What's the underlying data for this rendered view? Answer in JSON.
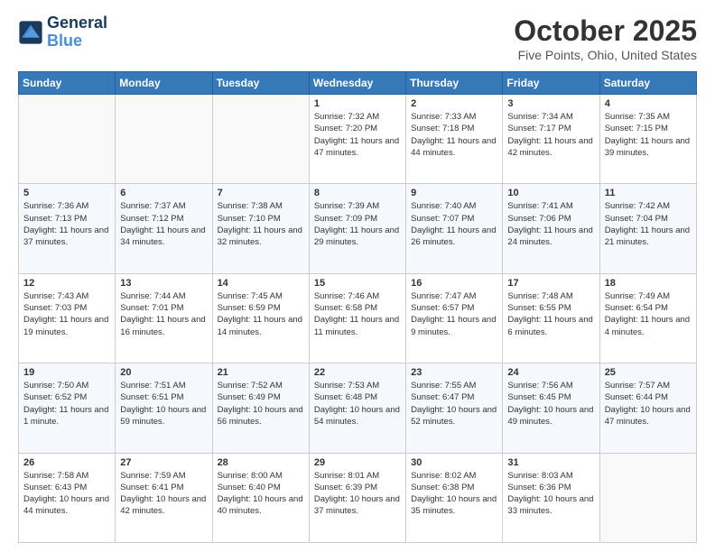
{
  "header": {
    "logo_line1": "General",
    "logo_line2": "Blue",
    "month_title": "October 2025",
    "location": "Five Points, Ohio, United States"
  },
  "weekdays": [
    "Sunday",
    "Monday",
    "Tuesday",
    "Wednesday",
    "Thursday",
    "Friday",
    "Saturday"
  ],
  "weeks": [
    [
      {
        "day": "",
        "sunrise": "",
        "sunset": "",
        "daylight": ""
      },
      {
        "day": "",
        "sunrise": "",
        "sunset": "",
        "daylight": ""
      },
      {
        "day": "",
        "sunrise": "",
        "sunset": "",
        "daylight": ""
      },
      {
        "day": "1",
        "sunrise": "Sunrise: 7:32 AM",
        "sunset": "Sunset: 7:20 PM",
        "daylight": "Daylight: 11 hours and 47 minutes."
      },
      {
        "day": "2",
        "sunrise": "Sunrise: 7:33 AM",
        "sunset": "Sunset: 7:18 PM",
        "daylight": "Daylight: 11 hours and 44 minutes."
      },
      {
        "day": "3",
        "sunrise": "Sunrise: 7:34 AM",
        "sunset": "Sunset: 7:17 PM",
        "daylight": "Daylight: 11 hours and 42 minutes."
      },
      {
        "day": "4",
        "sunrise": "Sunrise: 7:35 AM",
        "sunset": "Sunset: 7:15 PM",
        "daylight": "Daylight: 11 hours and 39 minutes."
      }
    ],
    [
      {
        "day": "5",
        "sunrise": "Sunrise: 7:36 AM",
        "sunset": "Sunset: 7:13 PM",
        "daylight": "Daylight: 11 hours and 37 minutes."
      },
      {
        "day": "6",
        "sunrise": "Sunrise: 7:37 AM",
        "sunset": "Sunset: 7:12 PM",
        "daylight": "Daylight: 11 hours and 34 minutes."
      },
      {
        "day": "7",
        "sunrise": "Sunrise: 7:38 AM",
        "sunset": "Sunset: 7:10 PM",
        "daylight": "Daylight: 11 hours and 32 minutes."
      },
      {
        "day": "8",
        "sunrise": "Sunrise: 7:39 AM",
        "sunset": "Sunset: 7:09 PM",
        "daylight": "Daylight: 11 hours and 29 minutes."
      },
      {
        "day": "9",
        "sunrise": "Sunrise: 7:40 AM",
        "sunset": "Sunset: 7:07 PM",
        "daylight": "Daylight: 11 hours and 26 minutes."
      },
      {
        "day": "10",
        "sunrise": "Sunrise: 7:41 AM",
        "sunset": "Sunset: 7:06 PM",
        "daylight": "Daylight: 11 hours and 24 minutes."
      },
      {
        "day": "11",
        "sunrise": "Sunrise: 7:42 AM",
        "sunset": "Sunset: 7:04 PM",
        "daylight": "Daylight: 11 hours and 21 minutes."
      }
    ],
    [
      {
        "day": "12",
        "sunrise": "Sunrise: 7:43 AM",
        "sunset": "Sunset: 7:03 PM",
        "daylight": "Daylight: 11 hours and 19 minutes."
      },
      {
        "day": "13",
        "sunrise": "Sunrise: 7:44 AM",
        "sunset": "Sunset: 7:01 PM",
        "daylight": "Daylight: 11 hours and 16 minutes."
      },
      {
        "day": "14",
        "sunrise": "Sunrise: 7:45 AM",
        "sunset": "Sunset: 6:59 PM",
        "daylight": "Daylight: 11 hours and 14 minutes."
      },
      {
        "day": "15",
        "sunrise": "Sunrise: 7:46 AM",
        "sunset": "Sunset: 6:58 PM",
        "daylight": "Daylight: 11 hours and 11 minutes."
      },
      {
        "day": "16",
        "sunrise": "Sunrise: 7:47 AM",
        "sunset": "Sunset: 6:57 PM",
        "daylight": "Daylight: 11 hours and 9 minutes."
      },
      {
        "day": "17",
        "sunrise": "Sunrise: 7:48 AM",
        "sunset": "Sunset: 6:55 PM",
        "daylight": "Daylight: 11 hours and 6 minutes."
      },
      {
        "day": "18",
        "sunrise": "Sunrise: 7:49 AM",
        "sunset": "Sunset: 6:54 PM",
        "daylight": "Daylight: 11 hours and 4 minutes."
      }
    ],
    [
      {
        "day": "19",
        "sunrise": "Sunrise: 7:50 AM",
        "sunset": "Sunset: 6:52 PM",
        "daylight": "Daylight: 11 hours and 1 minute."
      },
      {
        "day": "20",
        "sunrise": "Sunrise: 7:51 AM",
        "sunset": "Sunset: 6:51 PM",
        "daylight": "Daylight: 10 hours and 59 minutes."
      },
      {
        "day": "21",
        "sunrise": "Sunrise: 7:52 AM",
        "sunset": "Sunset: 6:49 PM",
        "daylight": "Daylight: 10 hours and 56 minutes."
      },
      {
        "day": "22",
        "sunrise": "Sunrise: 7:53 AM",
        "sunset": "Sunset: 6:48 PM",
        "daylight": "Daylight: 10 hours and 54 minutes."
      },
      {
        "day": "23",
        "sunrise": "Sunrise: 7:55 AM",
        "sunset": "Sunset: 6:47 PM",
        "daylight": "Daylight: 10 hours and 52 minutes."
      },
      {
        "day": "24",
        "sunrise": "Sunrise: 7:56 AM",
        "sunset": "Sunset: 6:45 PM",
        "daylight": "Daylight: 10 hours and 49 minutes."
      },
      {
        "day": "25",
        "sunrise": "Sunrise: 7:57 AM",
        "sunset": "Sunset: 6:44 PM",
        "daylight": "Daylight: 10 hours and 47 minutes."
      }
    ],
    [
      {
        "day": "26",
        "sunrise": "Sunrise: 7:58 AM",
        "sunset": "Sunset: 6:43 PM",
        "daylight": "Daylight: 10 hours and 44 minutes."
      },
      {
        "day": "27",
        "sunrise": "Sunrise: 7:59 AM",
        "sunset": "Sunset: 6:41 PM",
        "daylight": "Daylight: 10 hours and 42 minutes."
      },
      {
        "day": "28",
        "sunrise": "Sunrise: 8:00 AM",
        "sunset": "Sunset: 6:40 PM",
        "daylight": "Daylight: 10 hours and 40 minutes."
      },
      {
        "day": "29",
        "sunrise": "Sunrise: 8:01 AM",
        "sunset": "Sunset: 6:39 PM",
        "daylight": "Daylight: 10 hours and 37 minutes."
      },
      {
        "day": "30",
        "sunrise": "Sunrise: 8:02 AM",
        "sunset": "Sunset: 6:38 PM",
        "daylight": "Daylight: 10 hours and 35 minutes."
      },
      {
        "day": "31",
        "sunrise": "Sunrise: 8:03 AM",
        "sunset": "Sunset: 6:36 PM",
        "daylight": "Daylight: 10 hours and 33 minutes."
      },
      {
        "day": "",
        "sunrise": "",
        "sunset": "",
        "daylight": ""
      }
    ]
  ]
}
